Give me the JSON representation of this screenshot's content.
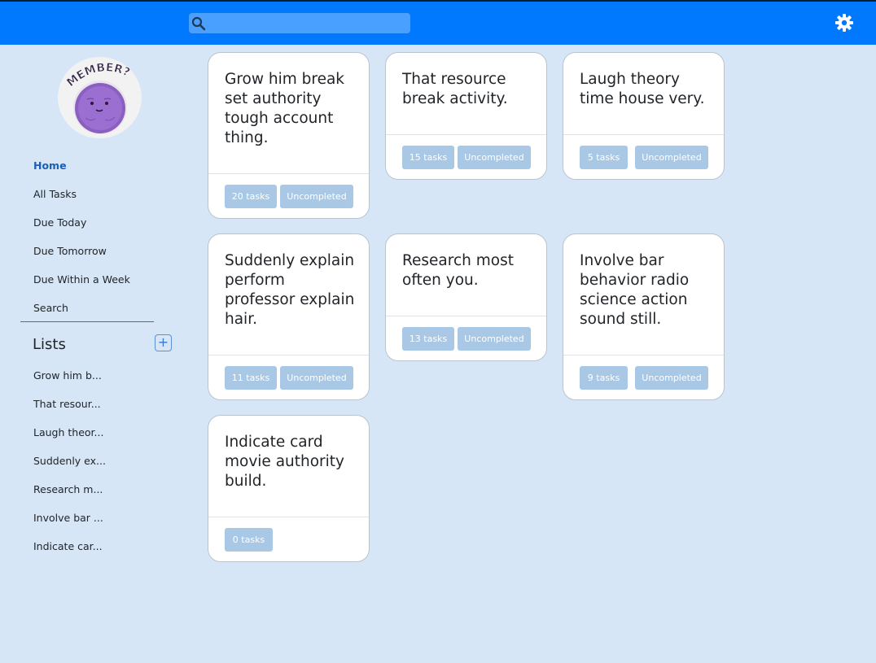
{
  "search": {
    "placeholder": "",
    "value": ""
  },
  "profile": {
    "avatar_text": "MEMBER?"
  },
  "nav": {
    "items": [
      {
        "label": "Home",
        "active": true
      },
      {
        "label": "All Tasks"
      },
      {
        "label": "Due Today"
      },
      {
        "label": "Due Tomorrow"
      },
      {
        "label": "Due Within a Week"
      },
      {
        "label": "Search"
      }
    ]
  },
  "lists": {
    "title": "Lists",
    "add_label": "+",
    "items": [
      "Grow him b...",
      "That resour...",
      "Laugh theor...",
      "Suddenly ex...",
      "Research m...",
      "Involve bar ...",
      "Indicate car..."
    ]
  },
  "cards": [
    {
      "title": "Grow him break set authority tough account thing.",
      "count": "20 tasks",
      "status": "Uncompleted"
    },
    {
      "title": "That resource break activity.",
      "count": "15 tasks",
      "status": "Uncompleted"
    },
    {
      "title": "Laugh theory time house very.",
      "count": "5 tasks",
      "status": "Uncompleted"
    },
    {
      "title": "Suddenly explain perform professor explain hair.",
      "count": "11 tasks",
      "status": "Uncompleted"
    },
    {
      "title": "Research most often you.",
      "count": "13 tasks",
      "status": "Uncompleted"
    },
    {
      "title": "Involve bar behavior radio science action sound still.",
      "count": "9 tasks",
      "status": "Uncompleted"
    },
    {
      "title": "Indicate card movie authority build.",
      "count": "0 tasks"
    }
  ],
  "colors": {
    "topbar": "#0079ff",
    "background": "#d6e6f6",
    "badge": "#a9c8e6",
    "active_nav": "#1a5fb4"
  },
  "icons": {
    "search": "search-icon",
    "settings": "gear-icon",
    "add": "plus-icon"
  }
}
